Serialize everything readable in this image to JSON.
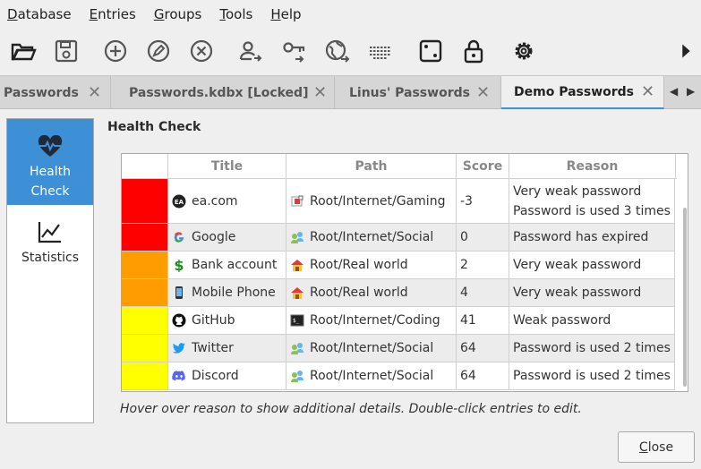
{
  "menubar": {
    "items": [
      {
        "mnemonic": "D",
        "rest": "atabase"
      },
      {
        "mnemonic": "E",
        "rest": "ntries"
      },
      {
        "mnemonic": "G",
        "rest": "roups"
      },
      {
        "mnemonic": "T",
        "rest": "ools"
      },
      {
        "mnemonic": "H",
        "rest": "elp"
      }
    ]
  },
  "tabs": [
    {
      "label": "Passwords",
      "active": false
    },
    {
      "label": "Passwords.kdbx [Locked]",
      "active": false
    },
    {
      "label": "Linus' Passwords",
      "active": false
    },
    {
      "label": "Demo Passwords",
      "active": true
    }
  ],
  "tab_close_glyph": "✕",
  "sidebar": {
    "items": [
      {
        "label_line1": "Health",
        "label_line2": "Check",
        "icon": "heartbeat-icon",
        "selected": true
      },
      {
        "label_line1": "Statistics",
        "label_line2": "",
        "icon": "chart-icon",
        "selected": false
      }
    ]
  },
  "panel": {
    "title": "Health Check",
    "columns": [
      "Title",
      "Path",
      "Score",
      "Reason"
    ],
    "rows": [
      {
        "color": "#ff0000",
        "title": "ea.com",
        "title_icon": "ea-icon",
        "path": "Root/Internet/Gaming",
        "path_icon": "gaming-folder-icon",
        "score": "-3",
        "reason1": "Very weak password",
        "reason2": "Password is used 3 times"
      },
      {
        "color": "#ff0000",
        "title": "Google",
        "title_icon": "google-icon",
        "path": "Root/Internet/Social",
        "path_icon": "social-folder-icon",
        "score": "0",
        "reason1": "Password has expired",
        "reason2": ""
      },
      {
        "color": "#ff9c00",
        "title": "Bank account",
        "title_icon": "dollar-icon",
        "path": "Root/Real world",
        "path_icon": "house-folder-icon",
        "score": "2",
        "reason1": "Very weak password",
        "reason2": ""
      },
      {
        "color": "#ff9c00",
        "title": "Mobile Phone",
        "title_icon": "phone-icon",
        "path": "Root/Real world",
        "path_icon": "house-folder-icon",
        "score": "4",
        "reason1": "Very weak password",
        "reason2": ""
      },
      {
        "color": "#ffff00",
        "title": "GitHub",
        "title_icon": "github-icon",
        "path": "Root/Internet/Coding",
        "path_icon": "terminal-folder-icon",
        "score": "41",
        "reason1": "Weak password",
        "reason2": ""
      },
      {
        "color": "#ffff00",
        "title": "Twitter",
        "title_icon": "twitter-icon",
        "path": "Root/Internet/Social",
        "path_icon": "social-folder-icon",
        "score": "64",
        "reason1": "Password is used 2 times",
        "reason2": ""
      },
      {
        "color": "#ffff00",
        "title": "Discord",
        "title_icon": "discord-icon",
        "path": "Root/Internet/Social",
        "path_icon": "social-folder-icon",
        "score": "64",
        "reason1": "Password is used 2 times",
        "reason2": ""
      }
    ]
  },
  "hint": "Hover over reason to show additional details. Double-click entries to edit.",
  "close_button": {
    "mnemonic": "C",
    "rest": "lose"
  },
  "accent_color": "#3d8fd6"
}
